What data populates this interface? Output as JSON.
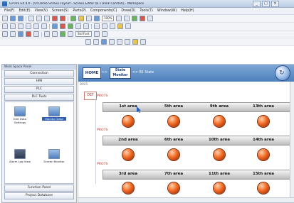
{
  "window": {
    "title": "GP-Pro EX 4.0 - [UI Demo Screen Layout - Screen Editor (B 1 Blink Control)] - Workspace",
    "controls": [
      "_",
      "□",
      "×"
    ]
  },
  "menu": [
    "File(F)",
    "Edit(E)",
    "View(V)",
    "Screen(S)",
    "Parts(P)",
    "Components(C)",
    "Draw(D)",
    "Tools(T)",
    "Window(W)",
    "Help(H)"
  ],
  "toolbar": {
    "zoom_value": "100%",
    "font_combo": "Std Font"
  },
  "left_panel": {
    "header": "Work Space Panel",
    "buttons": [
      "Connection",
      "HMI",
      "PLC",
      "PLC Tools"
    ],
    "items": [
      {
        "label": "Edit Data Settings",
        "selected": false
      },
      {
        "label": "Monitor Data",
        "selected": true
      },
      {
        "label": "Alarm Log View",
        "selected": false
      },
      {
        "label": "Screen Monitor",
        "selected": false
      }
    ],
    "footer_buttons": [
      "Function Panel",
      "Project Database"
    ]
  },
  "editor": {
    "home_label": "HOME",
    "link_label": ">>",
    "state_button": "State Monitor",
    "crumb": ">> B1 State",
    "ticker": "BR05",
    "flag": "DEF",
    "row_label": "PRO7S",
    "rows": [
      [
        "1st area",
        "5th area",
        "9th area",
        "13th area"
      ],
      [
        "2nd area",
        "6th area",
        "10th area",
        "14th area"
      ],
      [
        "3rd area",
        "7th area",
        "11th area",
        "15th area"
      ]
    ]
  }
}
